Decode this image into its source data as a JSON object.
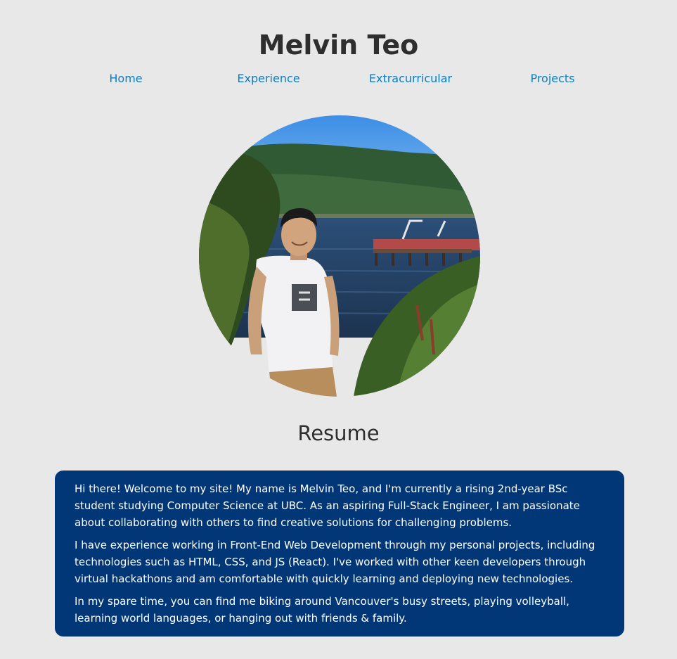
{
  "header": {
    "title": "Melvin Teo"
  },
  "nav": {
    "items": [
      {
        "label": "Home"
      },
      {
        "label": "Experience"
      },
      {
        "label": "Extracurricular"
      },
      {
        "label": "Projects"
      }
    ]
  },
  "profile": {
    "photo_icon": "profile-photo-icon"
  },
  "resume": {
    "label": "Resume"
  },
  "bio": {
    "paragraphs": [
      "Hi there! Welcome to my site! My name is Melvin Teo, and I'm currently a rising 2nd-year BSc student studying Computer Science at UBC. As an aspiring Full-Stack Engineer, I am passionate about collaborating with others to find creative solutions for challenging problems.",
      "I have experience working in Front-End Web Development through my personal projects, including technologies such as HTML, CSS, and JS (React). I've worked with other keen developers through virtual hackathons and am comfortable with quickly learning and deploying new technologies.",
      "In my spare time, you can find me biking around Vancouver's busy streets, playing volleyball, learning world languages, or hanging out with friends & family."
    ]
  },
  "colors": {
    "background": "#e8e8e8",
    "link": "#0a7ec2",
    "bio_background": "#013777",
    "text": "#2e2e2e"
  }
}
